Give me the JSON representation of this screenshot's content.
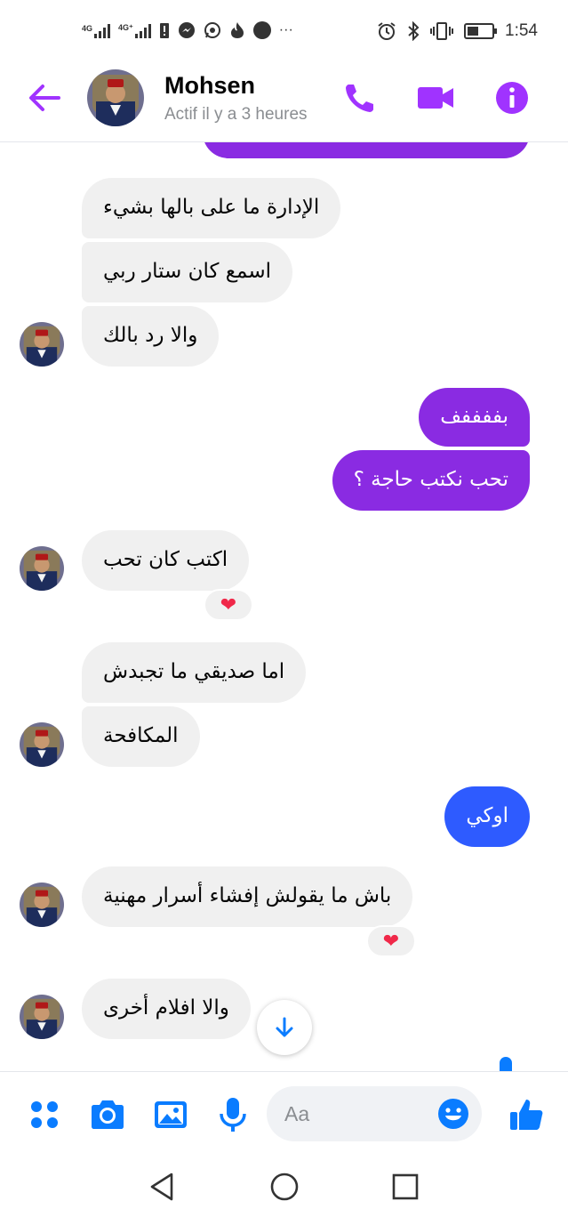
{
  "status_bar": {
    "network_1": "4G",
    "network_2": "4G⁺",
    "time": "1:54"
  },
  "header": {
    "contact_name": "Mohsen",
    "contact_status": "Actif il y a 3 heures",
    "accent_color": "#a033ff"
  },
  "messages": [
    {
      "from": "contact",
      "text": "الإدارة ما على بالها بشيء"
    },
    {
      "from": "contact",
      "text": "اسمع كان ستار ربي"
    },
    {
      "from": "contact",
      "text": "والا رد بالك"
    },
    {
      "from": "me",
      "text": "بففففف"
    },
    {
      "from": "me",
      "text": "تحب نكتب حاجة ؟"
    },
    {
      "from": "contact",
      "text": "اكتب كان تحب",
      "reaction": "❤"
    },
    {
      "from": "contact",
      "text": "اما صديقي ما تجبدش"
    },
    {
      "from": "contact",
      "text": "المكافحة"
    },
    {
      "from": "me",
      "text": "اوكي"
    },
    {
      "from": "contact",
      "text": "باش ما يقولش إفشاء أسرار مهنية",
      "reaction": "❤"
    },
    {
      "from": "contact",
      "text": "والا افلام أخرى"
    }
  ],
  "colors": {
    "outgoing_purple": "#8a2be2",
    "outgoing_blue": "#2e5bff",
    "incoming_gray": "#f0f0f0",
    "composer_blue": "#0a7cff",
    "reaction_red": "#f02849"
  },
  "composer": {
    "placeholder": "Aa",
    "icons": [
      "apps-icon",
      "camera-icon",
      "gallery-icon",
      "microphone-icon",
      "emoji-icon",
      "thumbs-up-icon"
    ]
  },
  "nav": {
    "icons": [
      "back-triangle-icon",
      "home-circle-icon",
      "recents-square-icon"
    ]
  }
}
